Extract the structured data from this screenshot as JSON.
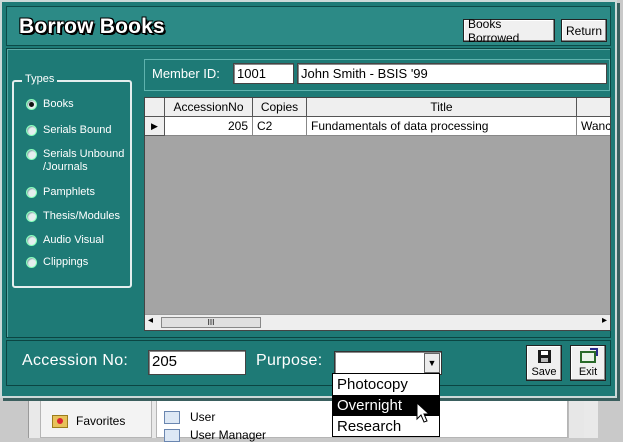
{
  "window": {
    "title": "Borrow Books",
    "buttons": {
      "books_borrowed": "Books Borrowed",
      "return": "Return"
    }
  },
  "types": {
    "legend": "Types",
    "items": [
      {
        "label": "Books",
        "selected": true
      },
      {
        "label": "Serials Bound",
        "selected": false
      },
      {
        "label": "Serials Unbound /Journals",
        "selected": false
      },
      {
        "label": "Pamphlets",
        "selected": false
      },
      {
        "label": "Thesis/Modules",
        "selected": false
      },
      {
        "label": "Audio Visual",
        "selected": false
      },
      {
        "label": "Clippings",
        "selected": false
      }
    ]
  },
  "member": {
    "label": "Member ID:",
    "id_value": "1001",
    "name_value": "John  Smith - BSIS '99"
  },
  "grid": {
    "columns": [
      "AccessionNo",
      "Copies",
      "Title",
      ""
    ],
    "rows": [
      {
        "accession": "205",
        "copies": "C2",
        "title": "Fundamentals of data processing",
        "extra": "Wanc"
      }
    ],
    "scroll": {
      "left": "◂",
      "thumb": "III",
      "right": "▸"
    }
  },
  "footer": {
    "accession_label": "Accession No:",
    "accession_value": "205",
    "purpose_label": "Purpose:",
    "purpose_value": "",
    "save_label": "Save",
    "exit_label": "Exit"
  },
  "purpose_options": [
    "Photocopy",
    "Overnight",
    "Research"
  ],
  "purpose_highlighted": "Overnight",
  "background_window": {
    "favorites_label": "Favorites",
    "items": [
      "User",
      "User Manager"
    ]
  },
  "colors": {
    "form_bg": "#1e7a76",
    "grid_bg": "#a4a4a4",
    "highlight": "#000000"
  }
}
